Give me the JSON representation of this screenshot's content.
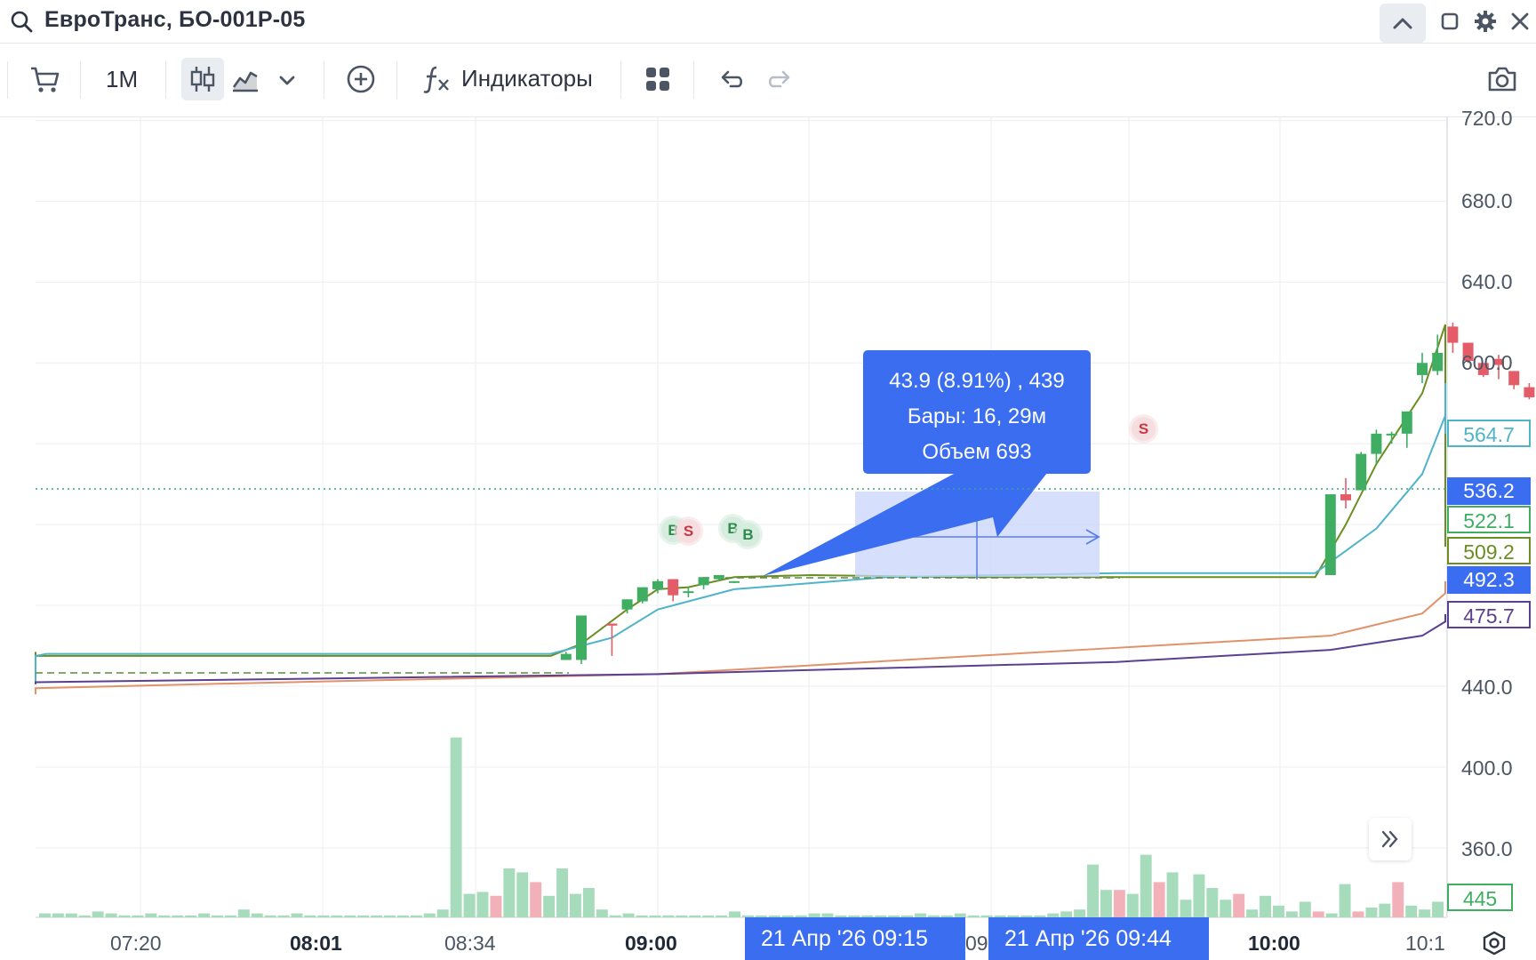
{
  "window": {
    "title": "ЕвроТранс, БО-001Р-05",
    "icons": [
      "search-icon",
      "chevron-up-icon",
      "maximize-icon",
      "gear-icon",
      "close-icon"
    ]
  },
  "toolbar": {
    "timeframe": "1M",
    "indicators_label": "Индикаторы",
    "icons": [
      "cart-icon",
      "candles-icon",
      "area-chart-icon",
      "chevron-down-icon",
      "add-circle-icon",
      "function-icon",
      "layout-grid-icon",
      "undo-icon",
      "redo-icon",
      "camera-icon"
    ]
  },
  "tooltip": {
    "change": "43.9 (8.91%) , 439",
    "bars": "Бары: 16, 29м",
    "volume": "Объем 693",
    "color": "#3b6df0"
  },
  "price_tags": [
    {
      "value": "564.7",
      "color": "#4fb3c9"
    },
    {
      "value": "536.2",
      "color": "#3b6df0"
    },
    {
      "value": "522.1",
      "color": "#3fae63"
    },
    {
      "value": "509.2",
      "color": "#6a8e22"
    },
    {
      "value": "492.3",
      "color": "#3b6df0"
    },
    {
      "value": "475.7",
      "color": "#5b3f91"
    },
    {
      "value": "445",
      "color": "#3fae63"
    }
  ],
  "x_axis": {
    "labels": [
      {
        "text": "07:20",
        "bold": false
      },
      {
        "text": "08:01",
        "bold": true
      },
      {
        "text": "08:34",
        "bold": false
      },
      {
        "text": "09:00",
        "bold": true
      },
      {
        "text": "10:00",
        "bold": true
      },
      {
        "text": "10:1",
        "bold": false
      }
    ],
    "range_start": "21 Апр '26   09:15",
    "range_end": "21 Апр '26   09:44",
    "partial_label": "09"
  },
  "markers": [
    {
      "label": "B",
      "type": "buy"
    },
    {
      "label": "S",
      "type": "sell"
    },
    {
      "label": "B",
      "type": "buy"
    },
    {
      "label": "B",
      "type": "buy"
    },
    {
      "label": "S",
      "type": "sell"
    }
  ],
  "chart_data": {
    "type": "candlestick",
    "y_axis": {
      "ticks": [
        "720.0",
        "680.0",
        "640.0",
        "600.0",
        "440.0",
        "400.0",
        "360.0"
      ],
      "range": [
        340,
        722
      ]
    },
    "candles": [
      {
        "time": "08:54",
        "open": 453,
        "high": 457,
        "low": 453,
        "close": 456
      },
      {
        "time": "08:55",
        "open": 453,
        "high": 475,
        "low": 451,
        "close": 475
      },
      {
        "time": "08:57",
        "open": 471,
        "high": 471,
        "low": 455,
        "close": 470
      },
      {
        "time": "08:58",
        "open": 478,
        "high": 483,
        "low": 476,
        "close": 483
      },
      {
        "time": "08:59",
        "open": 482,
        "high": 489,
        "low": 481,
        "close": 489
      },
      {
        "time": "09:00",
        "open": 488,
        "high": 493,
        "low": 486,
        "close": 492
      },
      {
        "time": "09:01",
        "open": 493,
        "high": 493,
        "low": 482,
        "close": 485
      },
      {
        "time": "09:02",
        "open": 487,
        "high": 489,
        "low": 484,
        "close": 487
      },
      {
        "time": "09:03",
        "open": 490,
        "high": 494,
        "low": 488,
        "close": 494
      },
      {
        "time": "09:04",
        "open": 493,
        "high": 495,
        "low": 492,
        "close": 495
      },
      {
        "time": "09:05",
        "open": 492,
        "high": 492,
        "low": 491,
        "close": 492
      },
      {
        "time": "09:44",
        "open": 495,
        "high": 535,
        "low": 495,
        "close": 535
      },
      {
        "time": "09:45",
        "open": 535,
        "high": 543,
        "low": 528,
        "close": 532
      },
      {
        "time": "09:46",
        "open": 537,
        "high": 556,
        "low": 537,
        "close": 555
      },
      {
        "time": "09:47",
        "open": 555,
        "high": 567,
        "low": 550,
        "close": 565
      },
      {
        "time": "09:48",
        "open": 565,
        "high": 566,
        "low": 560,
        "close": 565
      },
      {
        "time": "09:49",
        "open": 565,
        "high": 576,
        "low": 558,
        "close": 576
      },
      {
        "time": "09:50",
        "open": 594,
        "high": 605,
        "low": 590,
        "close": 600
      },
      {
        "time": "09:51",
        "open": 596,
        "high": 614,
        "low": 594,
        "close": 605
      },
      {
        "time": "09:52",
        "open": 618,
        "high": 620,
        "low": 605,
        "close": 610
      },
      {
        "time": "09:53",
        "open": 610,
        "high": 610,
        "low": 600,
        "close": 601
      },
      {
        "time": "09:54",
        "open": 600,
        "high": 600,
        "low": 593,
        "close": 594
      },
      {
        "time": "09:55",
        "open": 602,
        "high": 604,
        "low": 592,
        "close": 599
      },
      {
        "time": "09:56",
        "open": 596,
        "high": 596,
        "low": 587,
        "close": 589
      },
      {
        "time": "09:57",
        "open": 588,
        "high": 590,
        "low": 582,
        "close": 583
      },
      {
        "time": "09:58",
        "open": 583,
        "high": 583,
        "low": 561,
        "close": 562
      },
      {
        "time": "09:59",
        "open": 562,
        "high": 564,
        "low": 554,
        "close": 555
      },
      {
        "time": "10:00",
        "open": 556,
        "high": 556,
        "low": 532,
        "close": 536
      },
      {
        "time": "10:01",
        "open": 524,
        "high": 524,
        "low": 510,
        "close": 511
      },
      {
        "time": "10:02",
        "open": 512,
        "high": 520,
        "low": 507,
        "close": 514
      },
      {
        "time": "10:03",
        "open": 510,
        "high": 515,
        "low": 509,
        "close": 513
      },
      {
        "time": "10:04",
        "open": 519,
        "high": 523,
        "low": 512,
        "close": 522
      }
    ],
    "volume": [
      2,
      2,
      2,
      1,
      3,
      2,
      1,
      1,
      2,
      1,
      1,
      1,
      2,
      1,
      1,
      4,
      2,
      1,
      1,
      2,
      1,
      1,
      1,
      1,
      1,
      1,
      1,
      1,
      1,
      2,
      4,
      92,
      12,
      13,
      11,
      25,
      23,
      18,
      11,
      25,
      12,
      15,
      4,
      1,
      2,
      1,
      1,
      1,
      1,
      1,
      1,
      1,
      3,
      1,
      1,
      1,
      1,
      1,
      2,
      2,
      1,
      1,
      1,
      1,
      1,
      1,
      2,
      1,
      1,
      2,
      1,
      1,
      1,
      1,
      1,
      1,
      2,
      3,
      4,
      27,
      14,
      14,
      12,
      32,
      18,
      23,
      9,
      22,
      15,
      9,
      12,
      4,
      11,
      6,
      3,
      8,
      3,
      2,
      17,
      3,
      5,
      7,
      18,
      6,
      4,
      8
    ],
    "volume_max": 445,
    "lines": [
      {
        "name": "",
        "color": "#6a8e22",
        "last": 509.2
      },
      {
        "name": "",
        "color": "#4fb3c9",
        "last": 564.7
      },
      {
        "name": "",
        "color": "#e2926a",
        "last": 492.3
      },
      {
        "name": "",
        "color": "#5b3f91",
        "last": 475.7
      }
    ],
    "measurement": {
      "from_time": "09:15",
      "to_time": "09:44",
      "change": 43.9,
      "change_pct": 8.91,
      "bars": 16,
      "volume": 693
    },
    "current_price": 536.2
  }
}
